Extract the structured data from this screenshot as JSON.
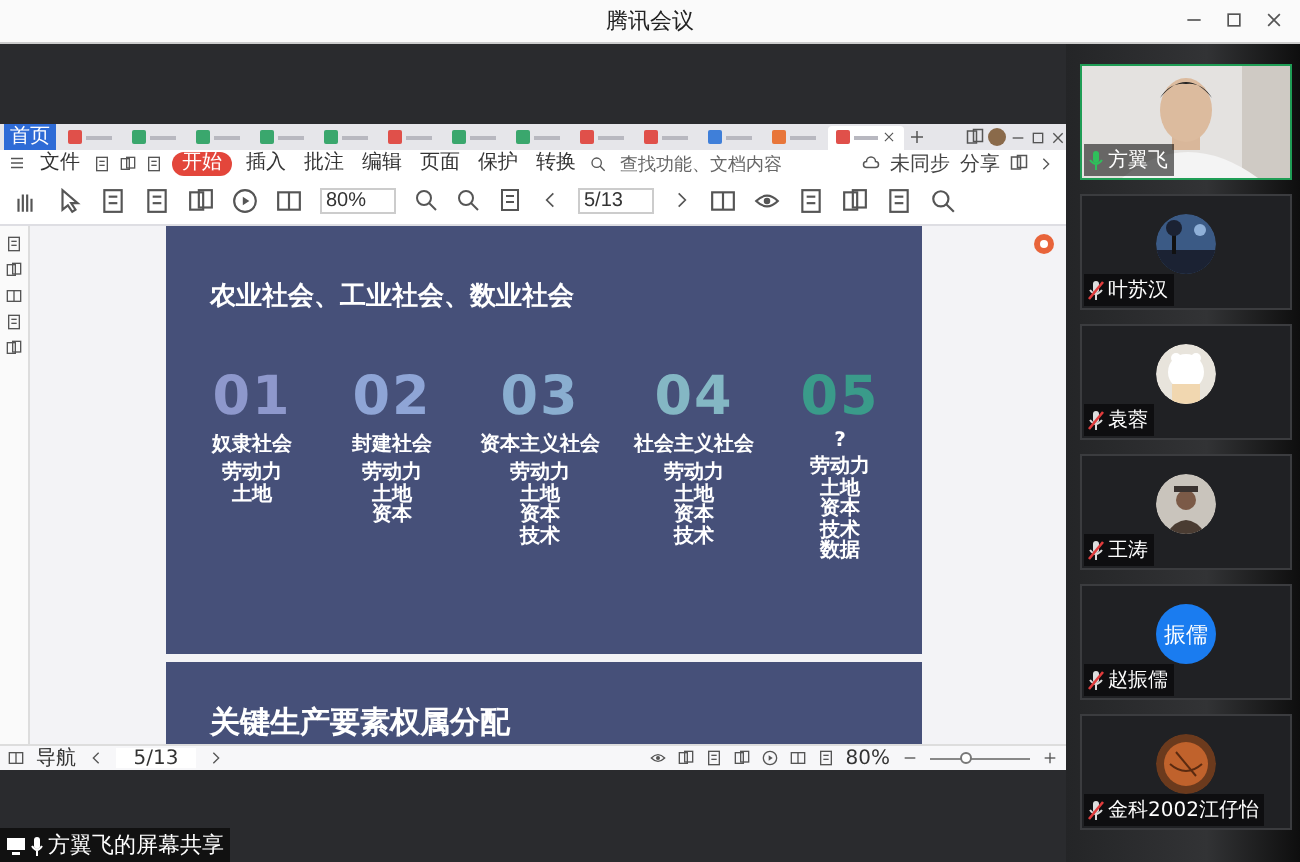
{
  "window": {
    "title": "腾讯会议"
  },
  "wps": {
    "tabs": [
      {
        "kind": "home",
        "label": "首页",
        "selected": false
      },
      {
        "kind": "doc",
        "color": "#e0504a",
        "selected": false
      },
      {
        "kind": "doc",
        "color": "#3aa76d",
        "selected": false
      },
      {
        "kind": "doc",
        "color": "#3aa76d",
        "selected": false
      },
      {
        "kind": "doc",
        "color": "#3aa76d",
        "selected": false
      },
      {
        "kind": "doc",
        "color": "#3aa76d",
        "selected": false
      },
      {
        "kind": "doc",
        "color": "#e0504a",
        "selected": false
      },
      {
        "kind": "doc",
        "color": "#3aa76d",
        "selected": false
      },
      {
        "kind": "doc",
        "color": "#3aa76d",
        "selected": false
      },
      {
        "kind": "doc",
        "color": "#e0504a",
        "selected": false
      },
      {
        "kind": "doc",
        "color": "#e0504a",
        "selected": false
      },
      {
        "kind": "doc",
        "color": "#3f7fd9",
        "selected": false
      },
      {
        "kind": "doc",
        "color": "#e8763a",
        "selected": false
      },
      {
        "kind": "doc",
        "color": "#e0504a",
        "selected": true
      }
    ],
    "file_menu": "文件",
    "menu": [
      {
        "label": "开始",
        "selected": true
      },
      {
        "label": "插入",
        "selected": false
      },
      {
        "label": "批注",
        "selected": false
      },
      {
        "label": "编辑",
        "selected": false
      },
      {
        "label": "页面",
        "selected": false
      },
      {
        "label": "保护",
        "selected": false
      },
      {
        "label": "转换",
        "selected": false
      }
    ],
    "search": {
      "placeholder": "查找功能、文档内容"
    },
    "sync": "未同步",
    "share": "分享",
    "zoom_field": "80%",
    "page_field": "5/13"
  },
  "slides": [
    {
      "title": "农业社会、工业社会、数业社会",
      "columns": [
        {
          "number": "01",
          "color": "#8e98cc",
          "name": "奴隶社会",
          "items": [
            "劳动力",
            "土地"
          ]
        },
        {
          "number": "02",
          "color": "#8fa5d6",
          "name": "封建社会",
          "items": [
            "劳动力",
            "土地",
            "资本"
          ]
        },
        {
          "number": "03",
          "color": "#8aaed0",
          "name": "资本主义社会",
          "items": [
            "劳动力",
            "土地",
            "资本",
            "技术"
          ]
        },
        {
          "number": "04",
          "color": "#84b7c4",
          "name": "社会主义社会",
          "items": [
            "劳动力",
            "土地",
            "资本",
            "技术"
          ]
        },
        {
          "number": "05",
          "color": "#3a9b8a",
          "name": "?",
          "items": [
            "劳动力",
            "土地",
            "资本",
            "技术",
            "数据"
          ]
        }
      ]
    },
    {
      "title": "关键生产要素权属分配"
    }
  ],
  "status_bar": {
    "nav": "导航",
    "page": "5/13",
    "zoom": "80%",
    "zoom_slider": {
      "level": 0.36
    }
  },
  "participants": [
    {
      "name": "方翼飞",
      "kind": "video",
      "muted": false,
      "speaking": true
    },
    {
      "name": "叶苏汉",
      "kind": "picture",
      "muted": true,
      "speaking": false
    },
    {
      "name": "袁蓉",
      "kind": "picture",
      "muted": true,
      "speaking": false
    },
    {
      "name": "王涛",
      "kind": "picture",
      "muted": true,
      "speaking": false
    },
    {
      "name": "赵振儒",
      "kind": "initials",
      "initials": "振儒",
      "color": "#1a7cf0",
      "muted": true,
      "speaking": false
    },
    {
      "name": "金科2002江仔怡",
      "kind": "picture",
      "muted": true,
      "speaking": false
    }
  ],
  "share_label": "方翼飞的屏幕共享"
}
